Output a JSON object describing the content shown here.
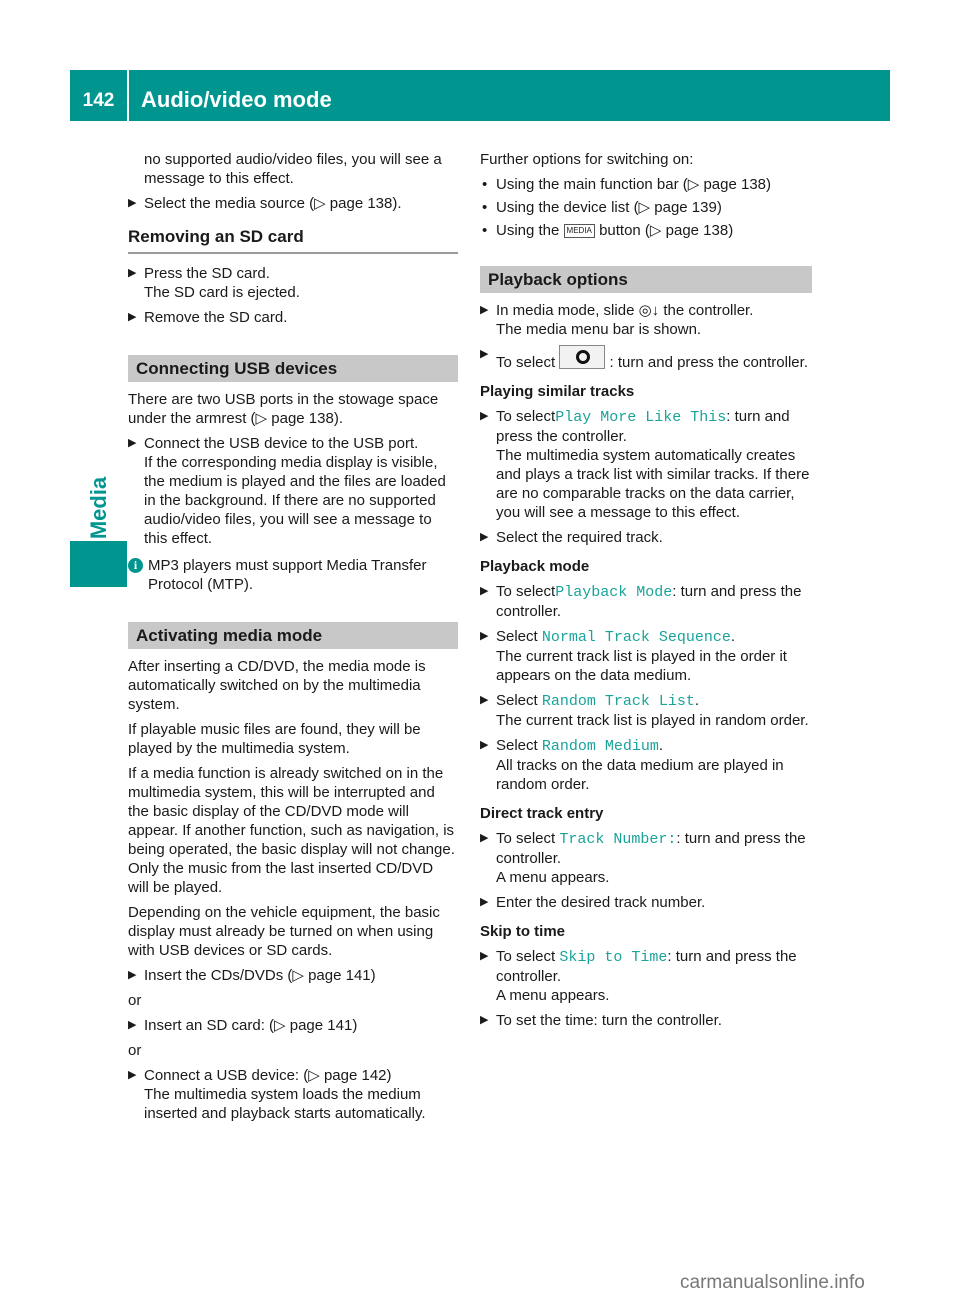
{
  "header": {
    "page_number": "142",
    "title": "Audio/video mode"
  },
  "sidebar": {
    "section_label": "Media"
  },
  "left": {
    "intro": "no supported audio/video files, you will see a message to this effect.",
    "intro_step": "Select the media source (▷ page 138).",
    "removing": {
      "heading": "Removing an SD card",
      "step1": "Press the SD card.",
      "step1_result": "The SD card is ejected.",
      "step2": "Remove the SD card."
    },
    "usb": {
      "heading": "Connecting USB devices",
      "intro": "There are two USB ports in the stowage space under the armrest (▷ page 138).",
      "step1": "Connect the USB device to the USB port.",
      "step1_result": "If the corresponding media display is visible, the medium is played and the files are loaded in the background. If there are no supported audio/video files, you will see a message to this effect.",
      "note": "MP3 players must support Media Transfer Protocol (MTP)."
    },
    "activating": {
      "heading": "Activating media mode",
      "p1": "After inserting a CD/DVD, the media mode is automatically switched on by the multimedia system.",
      "p2": "If playable music files are found, they will be played by the multimedia system.",
      "p3": "If a media function is already switched on in the multimedia system, this will be interrupted and the basic display of the CD/DVD mode will appear. If another function, such as navigation, is being operated, the basic display will not change. Only the music from the last inserted CD/DVD will be played.",
      "p4": "Depending on the vehicle equipment, the basic display must already be turned on when using with USB devices or SD cards.",
      "step1": "Insert the CDs/DVDs (▷ page 141)",
      "or1": "or",
      "step2": "Insert an SD card: (▷ page 141)",
      "or2": "or",
      "step3": "Connect a USB device: (▷ page 142)",
      "step3_result": "The multimedia system loads the medium inserted and playback starts automatically."
    }
  },
  "right": {
    "further": {
      "intro": "Further options for switching on:",
      "b1": "Using the main function bar (▷ page 138)",
      "b2": "Using the device list (▷ page 139)",
      "b3_pre": "Using the",
      "b3_key": "MEDIA",
      "b3_post": "button (▷ page 138)"
    },
    "playback": {
      "heading": "Playback options",
      "s1_pre": "In media mode, slide",
      "s1_sym": "◎↓",
      "s1_post": "the controller.",
      "s1_result": "The media menu bar is shown.",
      "s2_pre": "To select",
      "s2_post": ": turn and press the controller."
    },
    "similar": {
      "heading": "Playing similar tracks",
      "s1_pre": "To select",
      "s1_item": "Play More Like This",
      "s1_post": ": turn and press the controller.",
      "s1_result": "The multimedia system automatically creates and plays a track list with similar tracks. If there are no comparable tracks on the data carrier, you will see a message to this effect.",
      "s2": "Select the required track."
    },
    "mode": {
      "heading": "Playback mode",
      "s1_pre": "To select",
      "s1_item": "Playback Mode",
      "s1_post": ": turn and press the controller.",
      "s2_pre": "Select",
      "s2_item": "Normal Track Sequence",
      "s2_result": "The current track list is played in the order it appears on the data medium.",
      "s3_pre": "Select",
      "s3_item": "Random Track List",
      "s3_result": "The current track list is played in random order.",
      "s4_pre": "Select",
      "s4_item": "Random Medium",
      "s4_result": "All tracks on the data medium are played in random order."
    },
    "direct": {
      "heading": "Direct track entry",
      "s1_pre": "To select",
      "s1_item": "Track Number:",
      "s1_post": ": turn and press the controller.",
      "s1_result": "A menu appears.",
      "s2": "Enter the desired track number."
    },
    "skip": {
      "heading": "Skip to time",
      "s1_pre": "To select",
      "s1_item": "Skip to Time",
      "s1_post": ": turn and press the controller.",
      "s1_result": "A menu appears.",
      "s2": "To set the time: turn the controller."
    }
  },
  "period": ".",
  "watermark": "carmanualsonline.info"
}
